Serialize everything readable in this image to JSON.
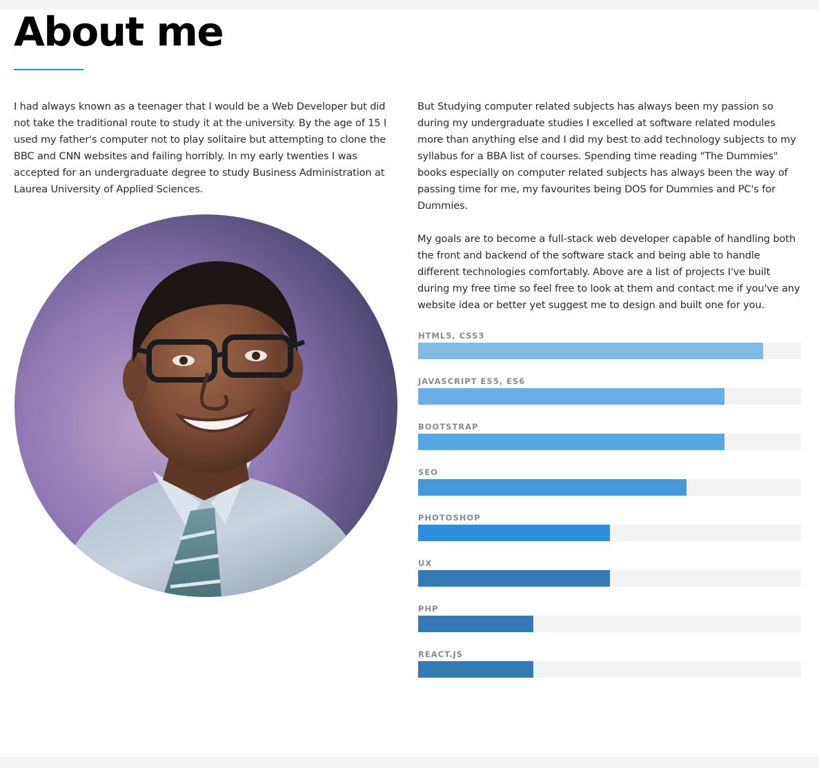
{
  "page": {
    "title": "About me",
    "accent_color": "#2d8fd5"
  },
  "intro": {
    "lines": [
      "I had always known as a teenager that I would be a Web Developer but did",
      "not take the traditional route to study it at the university. By the age of 15 I",
      "used my father's computer not to play solitaire but attempting to clone the",
      "BBC and CNN websites and failing horribly. In my early twenties I was",
      "accepted for an undergraduate degree to study Business Administration at",
      "Laurea University of Applied Sciences."
    ]
  },
  "study": {
    "lines": [
      "But Studying computer related subjects has always been my passion so",
      "during my undergraduate studies I excelled at software related modules",
      "more than anything else and I did my best to add technology subjects to my",
      "syllabus for a BBA list of courses. Spending time reading \"The Dummies\"",
      "books especially on computer related subjects has always been the way of",
      "passing time for me, my favourites being DOS for Dummies and PC's for",
      "Dummies."
    ]
  },
  "goals": {
    "lines": [
      "My goals are to become a full-stack web developer capable of handling both",
      "the front and backend of the software stack and being able to handle",
      "different technologies comfortably. Above are a list of projects I've built",
      "during my free time so feel free to look at them and contact me if you've any",
      "website idea or better yet suggest me to design and built one for you."
    ]
  },
  "avatar": {
    "icon": "portrait-illustration"
  },
  "skills": [
    {
      "label": "HTML5, CSS3",
      "level": 0.9,
      "color": "#7fbbe7"
    },
    {
      "label": "JAVASCRIPT ES5, ES6",
      "level": 0.8,
      "color": "#6aafe4"
    },
    {
      "label": "BOOTSTRAP",
      "level": 0.8,
      "color": "#56a6e0"
    },
    {
      "label": "SEO",
      "level": 0.7,
      "color": "#4499dc"
    },
    {
      "label": "PHOTOSHOP",
      "level": 0.5,
      "color": "#2d8edc"
    },
    {
      "label": "UX",
      "level": 0.5,
      "color": "#337ab7"
    },
    {
      "label": "PHP",
      "level": 0.3,
      "color": "#337ab7"
    },
    {
      "label": "REACT.JS",
      "level": 0.3,
      "color": "#337ab7"
    }
  ]
}
